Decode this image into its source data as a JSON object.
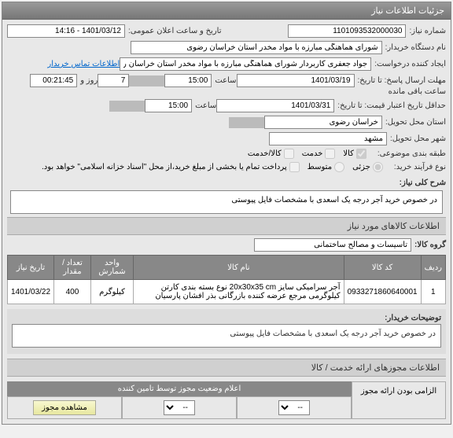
{
  "panel": {
    "title": "جزئیات اطلاعات نیاز"
  },
  "fields": {
    "need_no_label": "شماره نیاز:",
    "need_no": "1101093532000030",
    "announce_label": "تاریخ و ساعت اعلان عمومی:",
    "announce": "1401/03/12 - 14:16",
    "buyer_label": "نام دستگاه خریدار:",
    "buyer": "شورای هماهنگی مبارزه با مواد مخدر استان خراسان رضوی",
    "creator_label": "ایجاد کننده درخواست:",
    "creator": "جواد جعفری کاربردار شورای هماهنگی مبارزه با مواد مخدر استان خراسان رضوی",
    "contact_link": "اطلاعات تماس خریدار",
    "deadline_label": "مهلت ارسال پاسخ: تا تاریخ:",
    "deadline_date": "1401/03/19",
    "time_label": "ساعت",
    "deadline_time": "15:00",
    "days_count": "7",
    "days_label": "روز و",
    "remain_time": "00:21:45",
    "remain_label": "ساعت باقی مانده",
    "credit_label": "حداقل تاریخ اعتبار قیمت: تا تاریخ:",
    "credit_date": "1401/03/31",
    "credit_time": "15:00",
    "province_label": "استان محل تحویل:",
    "province": "خراسان رضوی",
    "city_label": "شهر محل تحویل:",
    "city": "مشهد",
    "subject_label": "طبقه بندی موضوعی:",
    "subj_kala": "کالا",
    "subj_khedmat": "خدمت",
    "subj_both": "کالا/خدمت",
    "process_label": "نوع فرآیند خرید:",
    "proc_small": "جزئی",
    "proc_med": "متوسط",
    "payment_note": "پرداخت تمام یا بخشی از مبلغ خرید،از محل \"اسناد خزانه اسلامی\" خواهد بود.",
    "need_title_label": "شرح کلی نیاز:",
    "need_title": "در خصوص خرید آجر درجه یک اسعدی با مشخصات فایل پیوستی"
  },
  "goods_section": "اطلاعات کالاهای مورد نیاز",
  "group_label": "گروه کالا:",
  "group_value": "تاسیسات و مصالح ساختمانی",
  "table": {
    "headers": {
      "row": "ردیف",
      "code": "کد کالا",
      "name": "نام کالا",
      "unit": "واحد شمارش",
      "qty": "تعداد / مقدار",
      "date": "تاریخ نیاز"
    },
    "rows": [
      {
        "idx": "1",
        "code": "0933271860640001",
        "name": "آجر سرامیکی سایز 20x30x35 cm نوع بسته بندی کارتن کیلوگرمی مرجع عرضه کننده بازرگانی بذر افشان پارسیان",
        "unit": "کیلوگرم",
        "qty": "400",
        "date": "1401/03/22"
      }
    ]
  },
  "buyer_note_label": "توضیحات خریدار:",
  "buyer_note": "در خصوص خرید آجر درجه یک اسعدی با مشخصات فایل پیوستی",
  "cert_section": "اطلاعات مجوزهای ارائه خدمت / کالا",
  "cert_mandatory": "الزامی بودن ارائه مجوز",
  "cert_status_header": "اعلام وضعیت مجوز توسط تامین کننده",
  "cert_view_btn": "مشاهده مجوز",
  "dash": "--"
}
